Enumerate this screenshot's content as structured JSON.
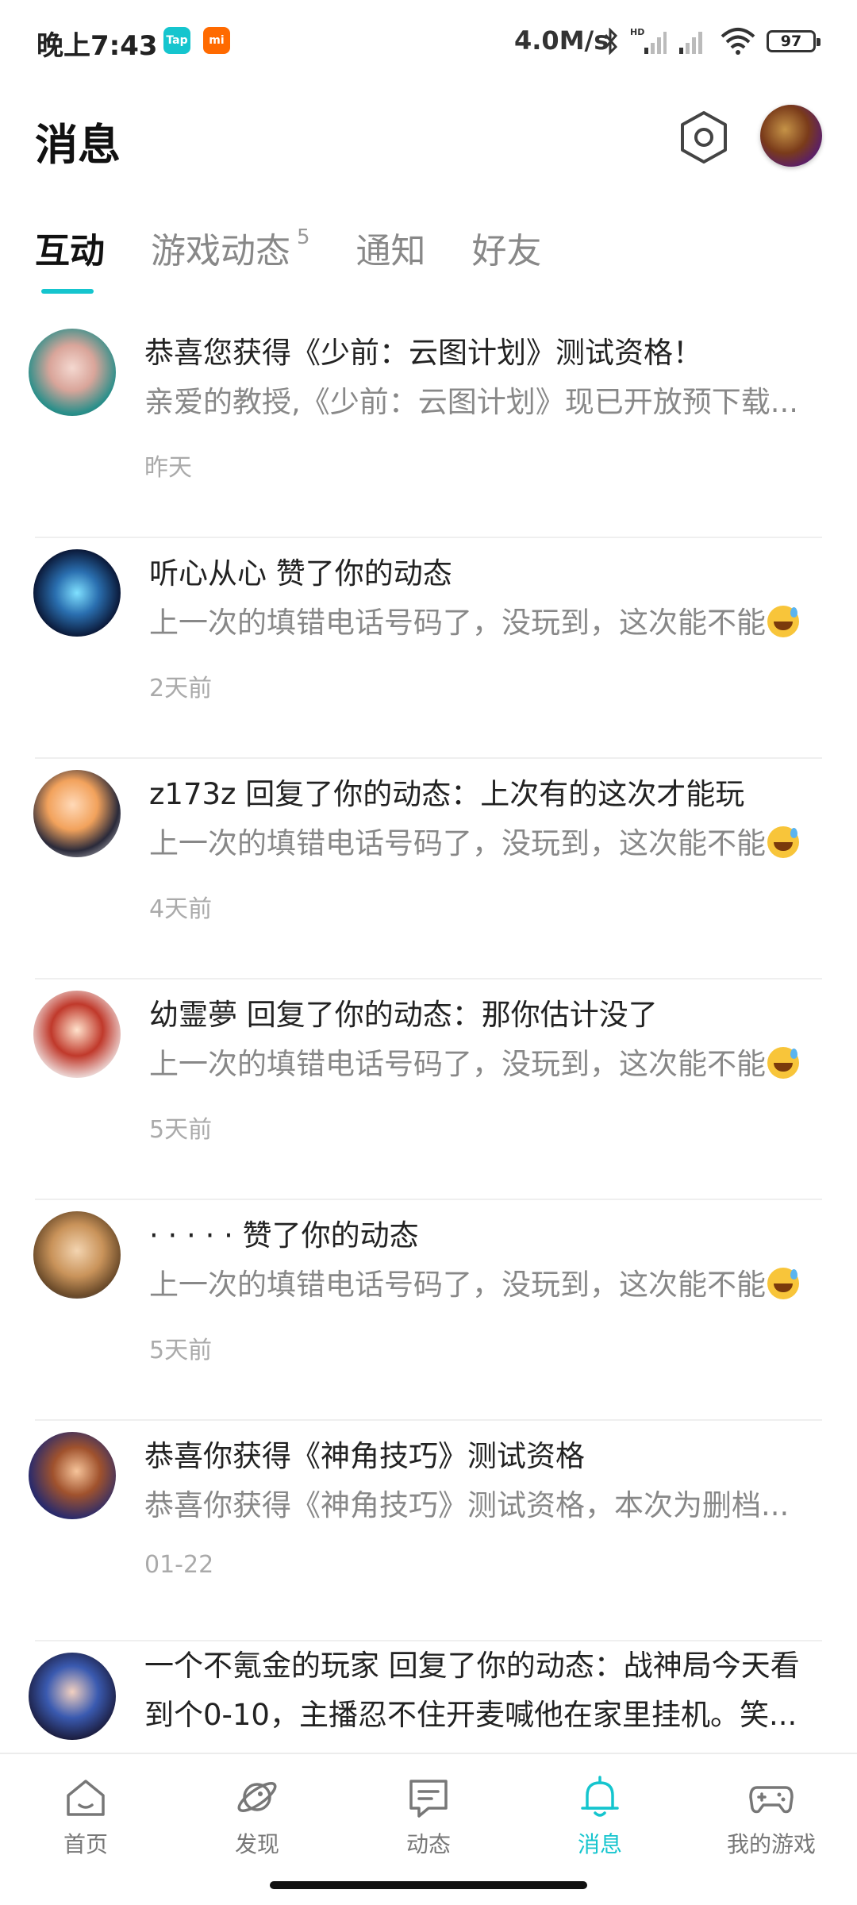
{
  "status_bar": {
    "time": "晚上7:43",
    "app1": "Tap",
    "app2": "mi",
    "net_speed": "4.0M/s",
    "battery": "97"
  },
  "header": {
    "title": "消息"
  },
  "tabs": [
    {
      "label": "互动",
      "active": true
    },
    {
      "label": "游戏动态",
      "badge": "5"
    },
    {
      "label": "通知"
    },
    {
      "label": "好友"
    }
  ],
  "messages": [
    {
      "title": "恭喜您获得《少前：云图计划》测试资格！",
      "subtitle": "亲爱的教授,《少前：云图计划》现已开放预下载...",
      "time": "昨天"
    },
    {
      "title": "听心从心 赞了你的动态",
      "subtitle": "上一次的填错电话号码了，没玩到，这次能不能",
      "time": "2天前"
    },
    {
      "title": "z173z 回复了你的动态：上次有的这次才能玩",
      "subtitle": "上一次的填错电话号码了，没玩到，这次能不能",
      "time": "4天前"
    },
    {
      "title": "幼霊夢 回复了你的动态：那你估计没了",
      "subtitle": "上一次的填错电话号码了，没玩到，这次能不能",
      "time": "5天前"
    },
    {
      "title": "· · · · ·  赞了你的动态",
      "subtitle": "上一次的填错电话号码了，没玩到，这次能不能",
      "time": "5天前"
    },
    {
      "title": "恭喜你获得《神角技巧》测试资格",
      "subtitle": "恭喜你获得《神角技巧》测试资格，本次为删档...",
      "time": "01-22"
    },
    {
      "title": "一个不氪金的玩家 回复了你的动态：战神局今天看到个0-10，主播忍不住开麦喊他在家里挂机。笑...",
      "subtitle": "",
      "time": ""
    }
  ],
  "bottom_nav": [
    {
      "label": "首页",
      "icon": "home-icon"
    },
    {
      "label": "发现",
      "icon": "planet-icon"
    },
    {
      "label": "动态",
      "icon": "chat-icon"
    },
    {
      "label": "消息",
      "icon": "bell-icon",
      "active": true
    },
    {
      "label": "我的游戏",
      "icon": "gamepad-icon"
    }
  ],
  "colors": {
    "accent": "#15c5ce",
    "text_primary": "#222222",
    "text_secondary": "#888888"
  }
}
